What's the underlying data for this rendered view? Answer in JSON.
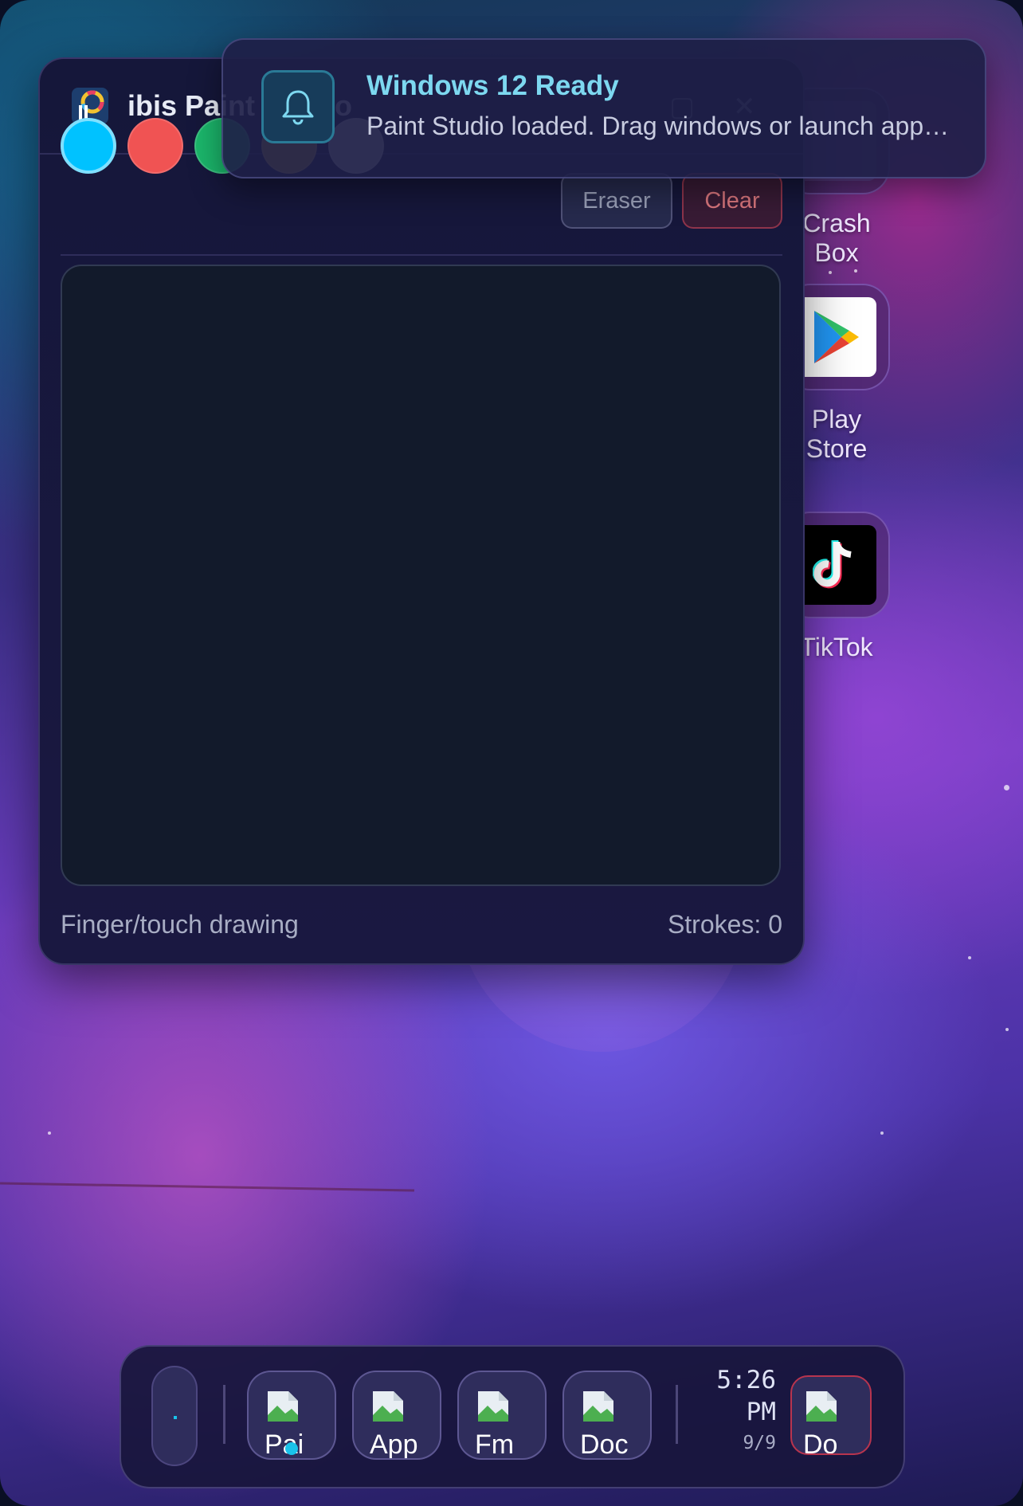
{
  "desktop": {
    "apps": [
      {
        "label": "Crash Box",
        "icon": "crash-box-icon"
      },
      {
        "label": "Play Store",
        "icon": "play-store-icon"
      },
      {
        "label": "TikTok",
        "icon": "tiktok-icon"
      }
    ]
  },
  "paint_window": {
    "title": "ibis Paint Studio",
    "colors": [
      "#00c2ff",
      "#f05353",
      "#1bb66b",
      "#d6ac3e",
      "#d9d9d9"
    ],
    "selected_color": "#00c2ff",
    "eraser_label": "Eraser",
    "clear_label": "Clear",
    "footer_hint": "Finger/touch drawing",
    "strokes_label": "Strokes: 0"
  },
  "toast": {
    "title": "Windows 12 Ready",
    "message": "Paint Studio loaded. Drag windows or launch apps from the taskbar."
  },
  "taskbar": {
    "apps": [
      {
        "label": "Pai",
        "icon": "broken-image-icon",
        "active": true
      },
      {
        "label": "App",
        "icon": "broken-image-icon",
        "active": false
      },
      {
        "label": "Fm",
        "icon": "broken-image-icon",
        "active": false
      },
      {
        "label": "Doc",
        "icon": "broken-image-icon",
        "active": false
      }
    ],
    "pinned": {
      "label": "Do",
      "icon": "broken-image-icon"
    },
    "time": "5:26",
    "ampm": "PM",
    "date": "9/9"
  }
}
